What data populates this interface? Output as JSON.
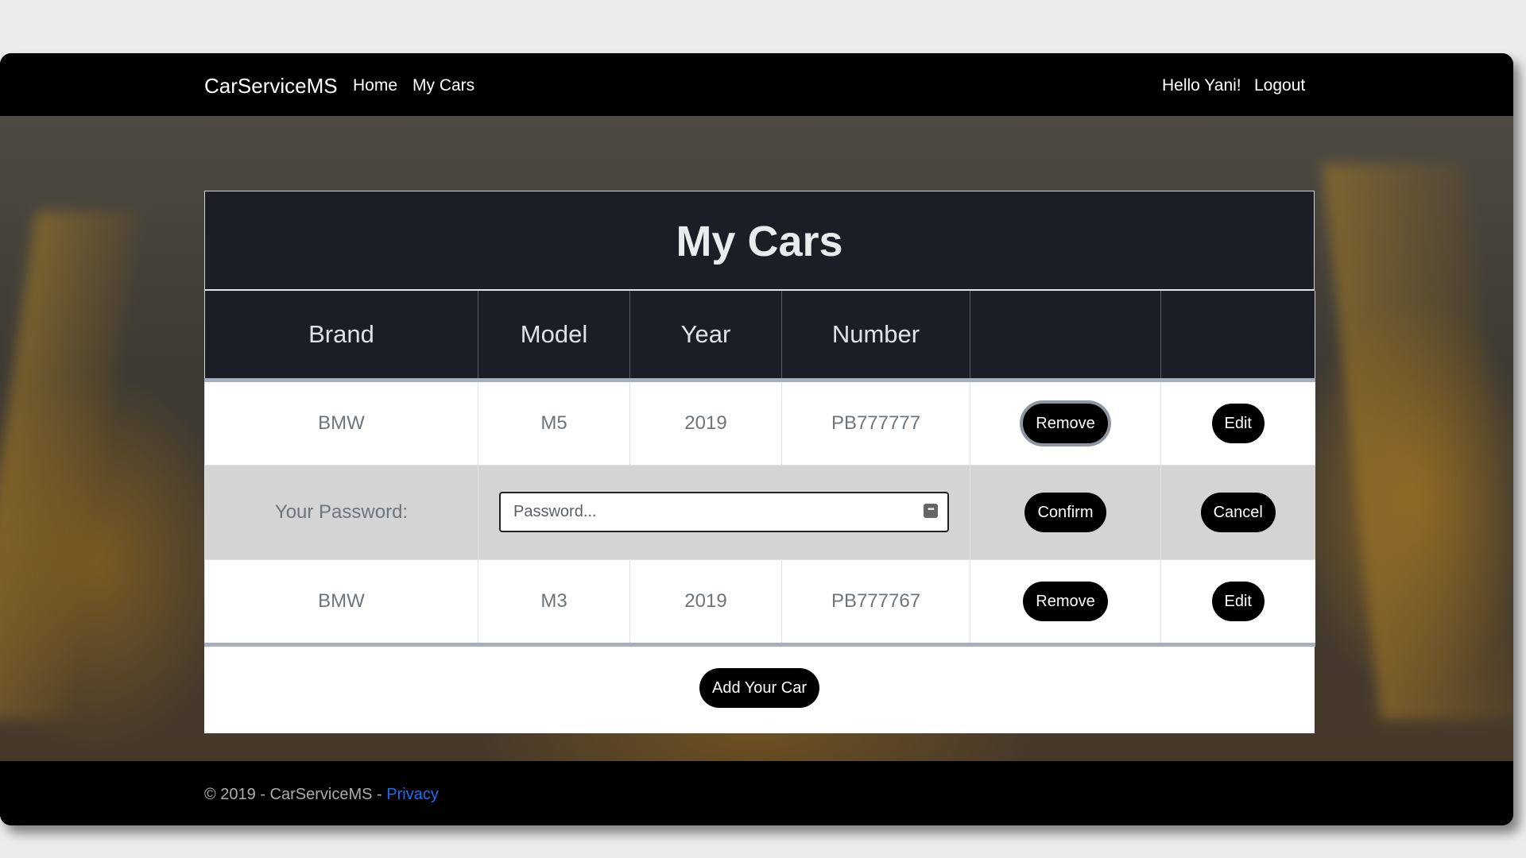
{
  "navbar": {
    "brand": "CarServiceMS",
    "links": [
      "Home",
      "My Cars"
    ],
    "greeting": "Hello Yani!",
    "logout": "Logout"
  },
  "page": {
    "title": "My Cars",
    "columns": [
      "Brand",
      "Model",
      "Year",
      "Number",
      "",
      ""
    ]
  },
  "cars": [
    {
      "brand": "BMW",
      "model": "M5",
      "year": "2019",
      "number": "PB777777",
      "remove": "Remove",
      "edit": "Edit"
    },
    {
      "brand": "BMW",
      "model": "M3",
      "year": "2019",
      "number": "PB777767",
      "remove": "Remove",
      "edit": "Edit"
    }
  ],
  "password_prompt": {
    "label": "Your Password:",
    "placeholder": "Password...",
    "value": "",
    "confirm": "Confirm",
    "cancel": "Cancel"
  },
  "add_button": "Add Your Car",
  "footer": {
    "text": "© 2019 - CarServiceMS - ",
    "privacy": "Privacy"
  }
}
